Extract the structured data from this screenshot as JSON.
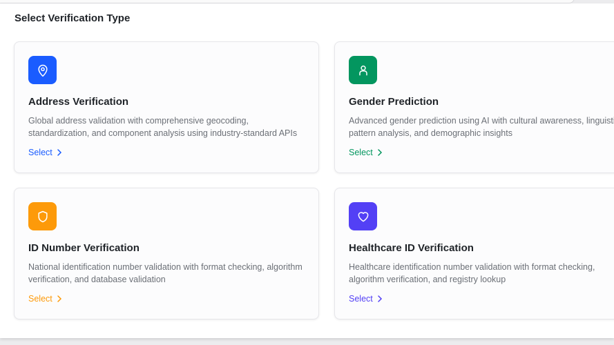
{
  "heading": "Select Verification Type",
  "cards": [
    {
      "title": "Address Verification",
      "description": "Global address validation with comprehensive geocoding, standardization, and component analysis using industry-standard APIs",
      "select_label": "Select",
      "icon": "map-pin-icon",
      "color": "#1a5cff"
    },
    {
      "title": "Gender Prediction",
      "description": "Advanced gender prediction using AI with cultural awareness, linguistic pattern analysis, and demographic insights",
      "select_label": "Select",
      "icon": "user-icon",
      "color": "#03965f"
    },
    {
      "title": "ID Number Verification",
      "description": "National identification number validation with format checking, algorithm verification, and database validation",
      "select_label": "Select",
      "icon": "shield-icon",
      "color": "#fd9a0a"
    },
    {
      "title": "Healthcare ID Verification",
      "description": "Healthcare identification number validation with format checking, algorithm verification, and registry lookup",
      "select_label": "Select",
      "icon": "heart-icon",
      "color": "#5340f5"
    }
  ]
}
